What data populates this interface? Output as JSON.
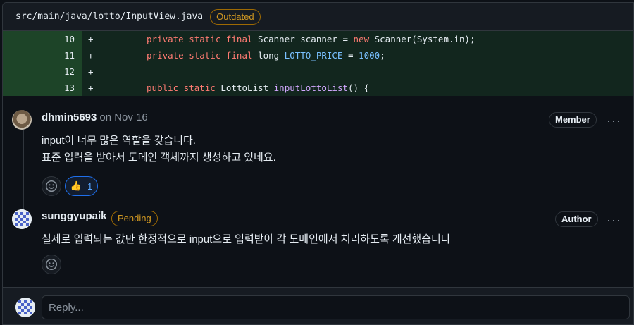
{
  "file": {
    "path": "src/main/java/lotto/InputView.java",
    "badge": "Outdated"
  },
  "diff": [
    {
      "line": "10",
      "sign": "+"
    },
    {
      "line": "11",
      "sign": "+"
    },
    {
      "line": "12",
      "sign": "+"
    },
    {
      "line": "13",
      "sign": "+"
    }
  ],
  "code_tokens": {
    "l10": {
      "kw1": "private static final",
      "type": " Scanner scanner = ",
      "kw2": "new",
      "rest": " Scanner(System.in);"
    },
    "l11": {
      "kw1": "private static final",
      "type": " long ",
      "const": "LOTTO_PRICE",
      "eq": " = ",
      "num": "1000",
      "end": ";"
    },
    "l13": {
      "kw1": "public static",
      "type": " LottoList ",
      "fn": "inputLottoList",
      "end": "() {"
    }
  },
  "comments": [
    {
      "author": "dhmin5693",
      "time": "on Nov 16",
      "role": "Member",
      "more": "···",
      "body": [
        "input이 너무 많은 역할을 갖습니다.",
        "표준 입력을 받아서 도메인 객체까지 생성하고 있네요."
      ],
      "reaction": {
        "emoji": "👍",
        "count": "1"
      },
      "add_reaction_icon": "smiley-icon"
    },
    {
      "author": "sunggyupaik",
      "status": "Pending",
      "role": "Author",
      "more": "···",
      "body": [
        "실제로 입력되는 값만 한정적으로 input으로 입력받아 각 도메인에서 처리하도록 개선했습니다"
      ],
      "add_reaction_icon": "smiley-icon"
    }
  ],
  "reply": {
    "placeholder": "Reply..."
  },
  "colors": {
    "accent": "#58a6ff",
    "warning": "#d29922",
    "added_bg": "#12261e"
  }
}
